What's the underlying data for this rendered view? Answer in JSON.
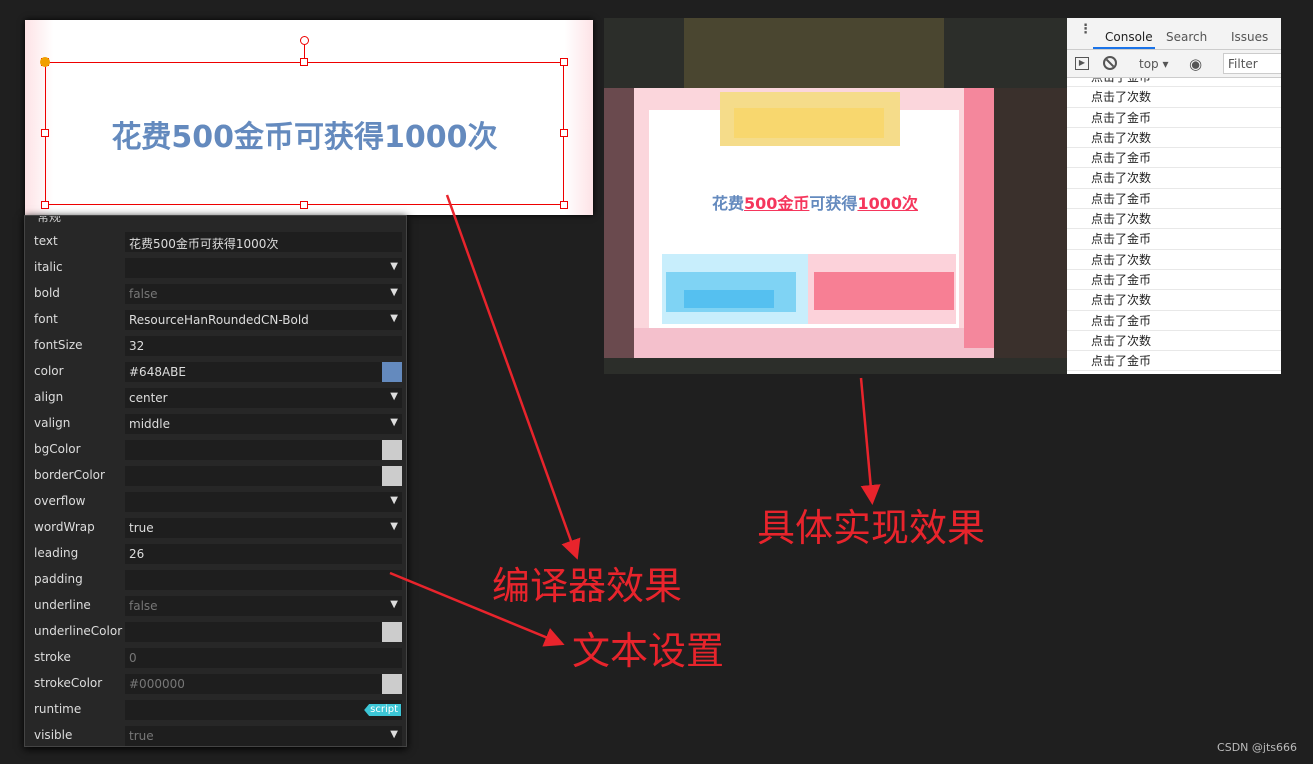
{
  "editor": {
    "preview_text": "花费500金币可获得1000次",
    "text_color": "#648ABE",
    "selection_color": "#e00000"
  },
  "panel": {
    "title": "常规",
    "properties": [
      {
        "label": "text",
        "value": "花费500金币可获得1000次",
        "kind": "text"
      },
      {
        "label": "italic",
        "value": "",
        "kind": "select"
      },
      {
        "label": "bold",
        "value": "false",
        "kind": "select",
        "dim": true
      },
      {
        "label": "font",
        "value": "ResourceHanRoundedCN-Bold",
        "kind": "select"
      },
      {
        "label": "fontSize",
        "value": "32",
        "kind": "text"
      },
      {
        "label": "color",
        "value": "#648ABE",
        "kind": "color",
        "swatch": "#648ABE"
      },
      {
        "label": "align",
        "value": "center",
        "kind": "select"
      },
      {
        "label": "valign",
        "value": "middle",
        "kind": "select"
      },
      {
        "label": "bgColor",
        "value": "",
        "kind": "color",
        "swatch": "#cccccc"
      },
      {
        "label": "borderColor",
        "value": "",
        "kind": "color",
        "swatch": "#cccccc"
      },
      {
        "label": "overflow",
        "value": "",
        "kind": "select"
      },
      {
        "label": "wordWrap",
        "value": "true",
        "kind": "select"
      },
      {
        "label": "leading",
        "value": "26",
        "kind": "text"
      },
      {
        "label": "padding",
        "value": "",
        "kind": "text"
      },
      {
        "label": "underline",
        "value": "false",
        "kind": "select",
        "dim": true
      },
      {
        "label": "underlineColor",
        "value": "",
        "kind": "color",
        "swatch": "#cccccc"
      },
      {
        "label": "stroke",
        "value": "0",
        "kind": "text",
        "dim": true
      },
      {
        "label": "strokeColor",
        "value": "#000000",
        "kind": "color",
        "swatch": "#cccccc",
        "dim": true
      },
      {
        "label": "runtime",
        "value": "",
        "kind": "script",
        "badge": "script"
      },
      {
        "label": "visible",
        "value": "true",
        "kind": "select",
        "dim": true
      }
    ]
  },
  "game": {
    "parts": [
      {
        "text": "花费",
        "color": "#648ABE"
      },
      {
        "text": "500金币",
        "color": "#f5365c",
        "underline": true
      },
      {
        "text": "可获得",
        "color": "#648ABE"
      },
      {
        "text": "1000次",
        "color": "#f5365c",
        "underline": true
      }
    ]
  },
  "console": {
    "tabs": [
      "Console",
      "Search",
      "Issues"
    ],
    "active_tab": "Console",
    "context": "top",
    "filter_placeholder": "Filter",
    "logs": [
      "点击了金币",
      "点击了次数",
      "点击了金币",
      "点击了次数",
      "点击了金币",
      "点击了次数",
      "点击了金币",
      "点击了次数",
      "点击了金币",
      "点击了次数",
      "点击了金币",
      "点击了次数",
      "点击了金币",
      "点击了次数",
      "点击了金币"
    ]
  },
  "annotations": {
    "editor_effect": "编译器效果",
    "text_settings": "文本设置",
    "actual_effect": "具体实现效果",
    "color": "#e8242c"
  },
  "watermark": "CSDN @jts666"
}
